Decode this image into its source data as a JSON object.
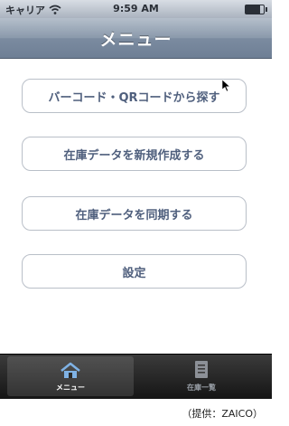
{
  "status_bar": {
    "carrier": "キャリア",
    "time": "9:59 AM"
  },
  "nav": {
    "title": "メニュー"
  },
  "menu": {
    "items": [
      {
        "label": "バーコード・QRコードから探す"
      },
      {
        "label": "在庫データを新規作成する"
      },
      {
        "label": "在庫データを同期する"
      },
      {
        "label": "設定"
      }
    ]
  },
  "tabbar": {
    "tabs": [
      {
        "label": "メニュー",
        "icon": "home-icon",
        "active": true
      },
      {
        "label": "在庫一覧",
        "icon": "document-icon",
        "active": false
      }
    ]
  },
  "caption": "（提供：ZAICO）",
  "colors": {
    "nav": "#7b8ba0",
    "button_text": "#4f5f7d",
    "tabbar": "#151515"
  }
}
